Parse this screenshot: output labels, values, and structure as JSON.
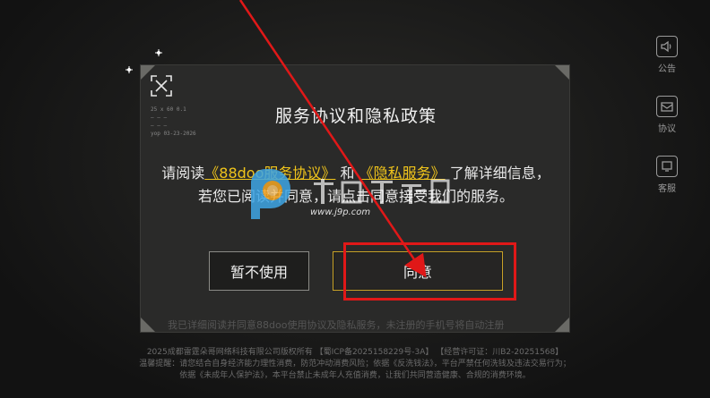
{
  "dialog": {
    "title": "服务协议和隐私政策",
    "body_prefix": "请阅读",
    "link_service": "《88doo服务协议》",
    "body_and": "和",
    "link_privacy": "《隐私服务》",
    "body_suffix": "了解详细信息，",
    "body_line2": "若您已阅读并同意，请点击同意接受我们的服务。",
    "decline_label": "暂不使用",
    "agree_label": "同意",
    "note": "我已详细阅读并同意88doo使用协议及隐私服务，未注册的手机号将自动注册"
  },
  "nav": {
    "items": [
      {
        "label": "公告",
        "icon": "speaker-icon"
      },
      {
        "label": "协议",
        "icon": "mail-icon"
      },
      {
        "label": "客服",
        "icon": "headset-icon"
      }
    ]
  },
  "fullscreen_widget": {
    "info_lines": [
      "25 x 60 0.1",
      "— — —",
      "— — —",
      "yop 03-23-2026"
    ]
  },
  "watermark": {
    "url": "www.j9p.com"
  },
  "footer": {
    "line1": "2025成都雷霆朵哥网络科技有限公司版权所有 【蜀ICP备2025158229号-3A】 【经营许可证：川B2-20251568】",
    "line2": "温馨提醒：请您结合自身经济能力理性消费，防范冲动消费风险；依据《反洗钱法》，平台严禁任何洗钱及违法交易行为；",
    "line3": "依据《未成年人保护法》，本平台禁止未成年人充值消费，让我们共同营造健康、合规的消费环境。"
  },
  "colors": {
    "accent": "#f1c51b",
    "annotation": "#e01818"
  }
}
